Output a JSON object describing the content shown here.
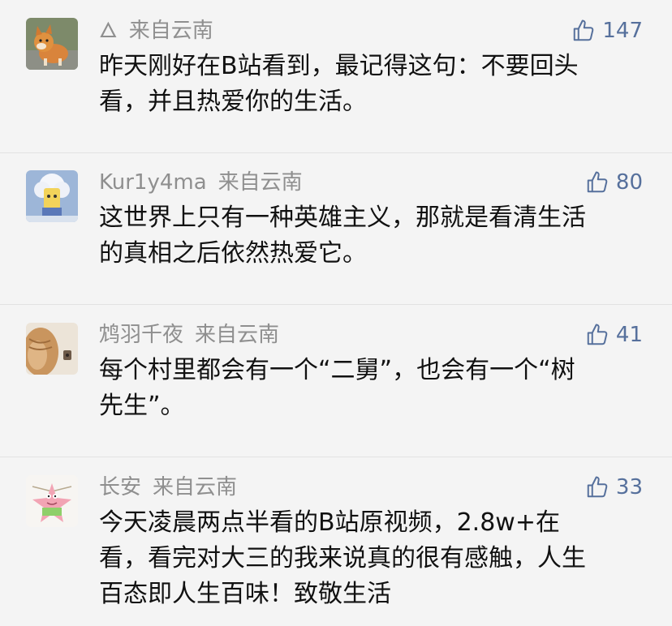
{
  "comments": [
    {
      "name": "🜂",
      "location": "来自云南",
      "likes": "147",
      "avatar_icon": "shiba-dog-avatar",
      "text": [
        "昨天刚好在B站看到，最记得这句：不要回头",
        "看，并且热爱你的生活。"
      ]
    },
    {
      "name": "Kur1y4ma",
      "location": "来自云南",
      "likes": "80",
      "avatar_icon": "cartoon-character-avatar",
      "text": [
        "这世界上只有一种英雄主义，那就是看清生活",
        "的真相之后依然热爱它。"
      ]
    },
    {
      "name": "鸩羽千夜",
      "location": "来自云南",
      "likes": "41",
      "avatar_icon": "cat-avatar",
      "text": [
        "每个村里都会有一个“二舅”，也会有一个“树",
        "先生”。"
      ]
    },
    {
      "name": "长安",
      "location": "来自云南",
      "likes": "33",
      "avatar_icon": "patrick-star-avatar",
      "text": [
        "今天凌晨两点半看的B站原视频，2.8w+在",
        "看，看完对大三的我来说真的很有感触，人生",
        "百态即人生百味！致敬生活"
      ]
    }
  ],
  "like_icon": "thumbs-up-icon"
}
